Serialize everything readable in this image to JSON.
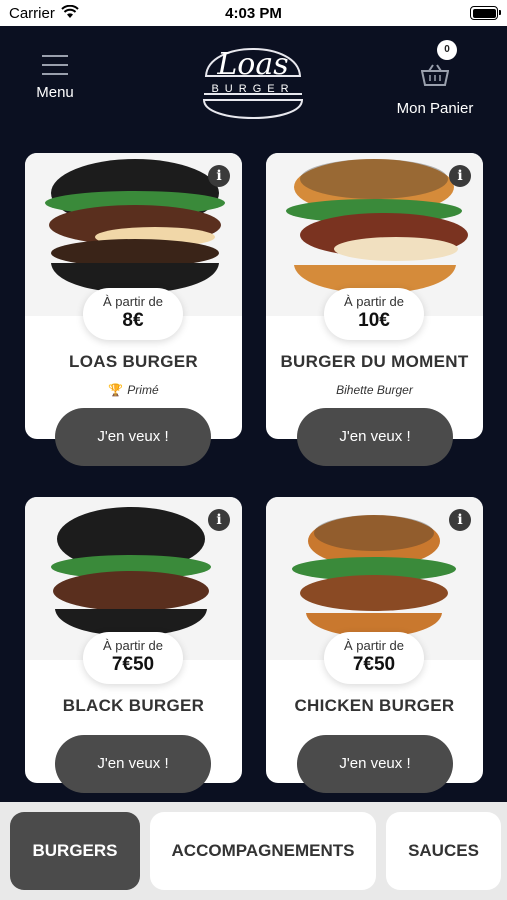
{
  "status": {
    "carrier": "Carrier",
    "time": "4:03 PM"
  },
  "header": {
    "menu_label": "Menu",
    "logo_top": "Loas",
    "logo_bottom": "BURGER",
    "cart_label": "Mon Panier",
    "cart_count": "0"
  },
  "products": [
    {
      "price_from": "À partir de",
      "price": "8€",
      "name": "LOAS BURGER",
      "tag": "Primé",
      "tag_icon": "trophy-icon",
      "cta": "J'en veux !",
      "bun": "#1c1c1c"
    },
    {
      "price_from": "À partir de",
      "price": "10€",
      "name": "BURGER DU MOMENT",
      "tag": "Bihette Burger",
      "cta": "J'en veux !",
      "bun": "#d58b3a"
    },
    {
      "price_from": "À partir de",
      "price": "7€50",
      "name": "BLACK BURGER",
      "tag": "",
      "cta": "J'en veux !",
      "bun": "#1c1c1c"
    },
    {
      "price_from": "À partir de",
      "price": "7€50",
      "name": "CHICKEN BURGER",
      "tag": "",
      "cta": "J'en veux !",
      "bun": "#c9782e"
    }
  ],
  "tabs": [
    {
      "label": "BURGERS",
      "active": true
    },
    {
      "label": "ACCOMPAGNEMENTS",
      "active": false
    },
    {
      "label": "SAUCES",
      "active": false
    }
  ],
  "colors": {
    "background": "#0b1021",
    "button": "#4b4b4b",
    "tabbar": "#e9e9e9"
  }
}
